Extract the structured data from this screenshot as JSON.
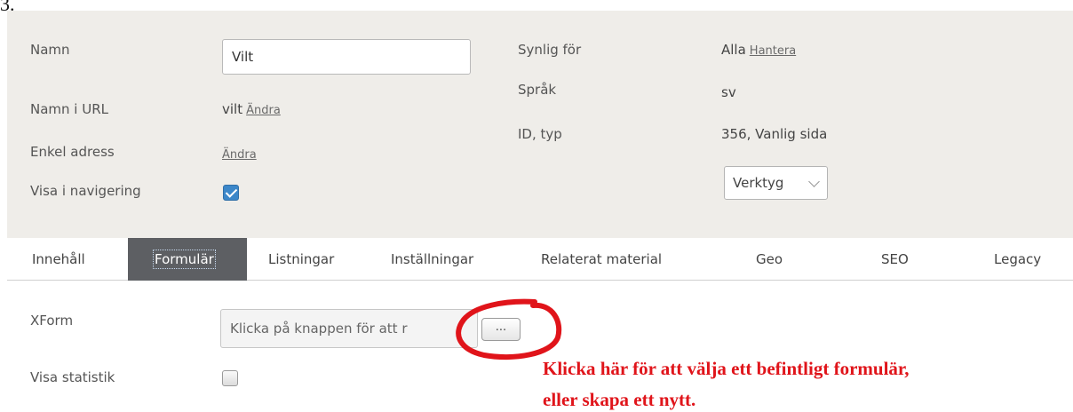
{
  "step_number": "3.",
  "header": {
    "name_label": "Namn",
    "name_value": "Vilt",
    "url_name_label": "Namn i URL",
    "url_name_value": "vilt",
    "url_name_link": "Ändra",
    "simple_address_label": "Enkel adress",
    "simple_address_link": "Ändra",
    "show_in_nav_label": "Visa i navigering",
    "show_in_nav_checked": true,
    "visible_for_label": "Synlig för",
    "visible_for_value": "Alla",
    "visible_for_link": "Hantera",
    "language_label": "Språk",
    "language_value": "sv",
    "id_type_label": "ID, typ",
    "id_type_value": "356, Vanlig sida",
    "tools_select_value": "Verktyg"
  },
  "tabs": [
    {
      "label": "Innehåll",
      "active": false
    },
    {
      "label": "Formulär",
      "active": true
    },
    {
      "label": "Listningar",
      "active": false
    },
    {
      "label": "Inställningar",
      "active": false
    },
    {
      "label": "Relaterat material",
      "active": false
    },
    {
      "label": "Geo",
      "active": false
    },
    {
      "label": "SEO",
      "active": false
    },
    {
      "label": "Legacy",
      "active": false
    }
  ],
  "form": {
    "xform_label": "XForm",
    "xform_value": "Klicka på knappen för att r",
    "browse_button_label": "...",
    "show_stats_label": "Visa statistik",
    "show_stats_checked": false
  },
  "annotation": {
    "line1": "Klicka här för att välja ett befintligt formulär,",
    "line2": "eller skapa ett nytt.",
    "color": "#e0141a"
  },
  "colors": {
    "header_bg": "#efede9",
    "active_tab_bg": "#5d5f63",
    "checkbox_blue": "#3c87c9"
  }
}
